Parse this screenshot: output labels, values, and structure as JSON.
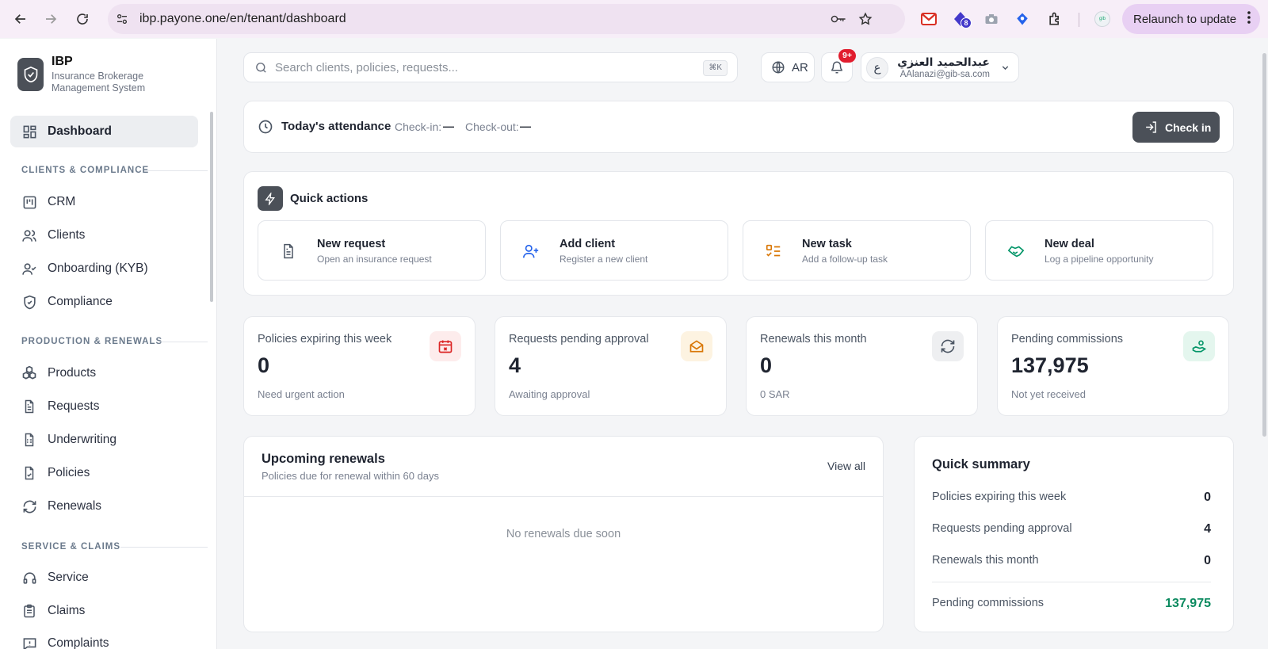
{
  "browser": {
    "url": "ibp.payone.one/en/tenant/dashboard",
    "relaunch_label": "Relaunch to update",
    "ext_badge": "8"
  },
  "sidebar": {
    "brand": "IBP",
    "brand_sub": "Insurance Brokerage Management System",
    "dashboard": "Dashboard",
    "sections": {
      "clients": "CLIENTS & COMPLIANCE",
      "production": "PRODUCTION & RENEWALS",
      "service": "SERVICE & CLAIMS"
    },
    "items": {
      "crm": "CRM",
      "clients": "Clients",
      "onboarding": "Onboarding (KYB)",
      "compliance": "Compliance",
      "products": "Products",
      "requests": "Requests",
      "underwriting": "Underwriting",
      "policies": "Policies",
      "renewals": "Renewals",
      "service": "Service",
      "claims": "Claims",
      "complaints": "Complaints"
    }
  },
  "header": {
    "search_placeholder": "Search clients, policies, requests...",
    "search_kbd": "⌘K",
    "lang": "AR",
    "notif_count": "9+",
    "avatar_letter": "ع",
    "user_name": "عبدالحميد العنزي",
    "user_email": "AAlanazi@gib-sa.com"
  },
  "attendance": {
    "title": "Today's attendance",
    "checkin_label": "Check-in:",
    "checkin_value": "—",
    "checkout_label": "Check-out:",
    "checkout_value": "—",
    "button": "Check in"
  },
  "quick_actions": {
    "title": "Quick actions",
    "items": [
      {
        "title": "New request",
        "sub": "Open an insurance request"
      },
      {
        "title": "Add client",
        "sub": "Register a new client"
      },
      {
        "title": "New task",
        "sub": "Add a follow-up task"
      },
      {
        "title": "New deal",
        "sub": "Log a pipeline opportunity"
      }
    ]
  },
  "stats": [
    {
      "label": "Policies expiring this week",
      "value": "0",
      "desc": "Need urgent action",
      "color": "#dc2626"
    },
    {
      "label": "Requests pending approval",
      "value": "4",
      "desc": "Awaiting approval",
      "color": "#d97706"
    },
    {
      "label": "Renewals this month",
      "value": "0",
      "desc": "0 SAR",
      "color": "#4b5563"
    },
    {
      "label": "Pending commissions",
      "value": "137,975",
      "desc": "Not yet received",
      "color": "#059669"
    }
  ],
  "renewals": {
    "title": "Upcoming renewals",
    "subtitle": "Policies due for renewal within 60 days",
    "view_all": "View all",
    "empty": "No renewals due soon"
  },
  "summary": {
    "title": "Quick summary",
    "rows": [
      {
        "label": "Policies expiring this week",
        "value": "0"
      },
      {
        "label": "Requests pending approval",
        "value": "4"
      },
      {
        "label": "Renewals this month",
        "value": "0"
      },
      {
        "label": "Pending commissions",
        "value": "137,975"
      }
    ],
    "accent": "#0b8a5f"
  }
}
